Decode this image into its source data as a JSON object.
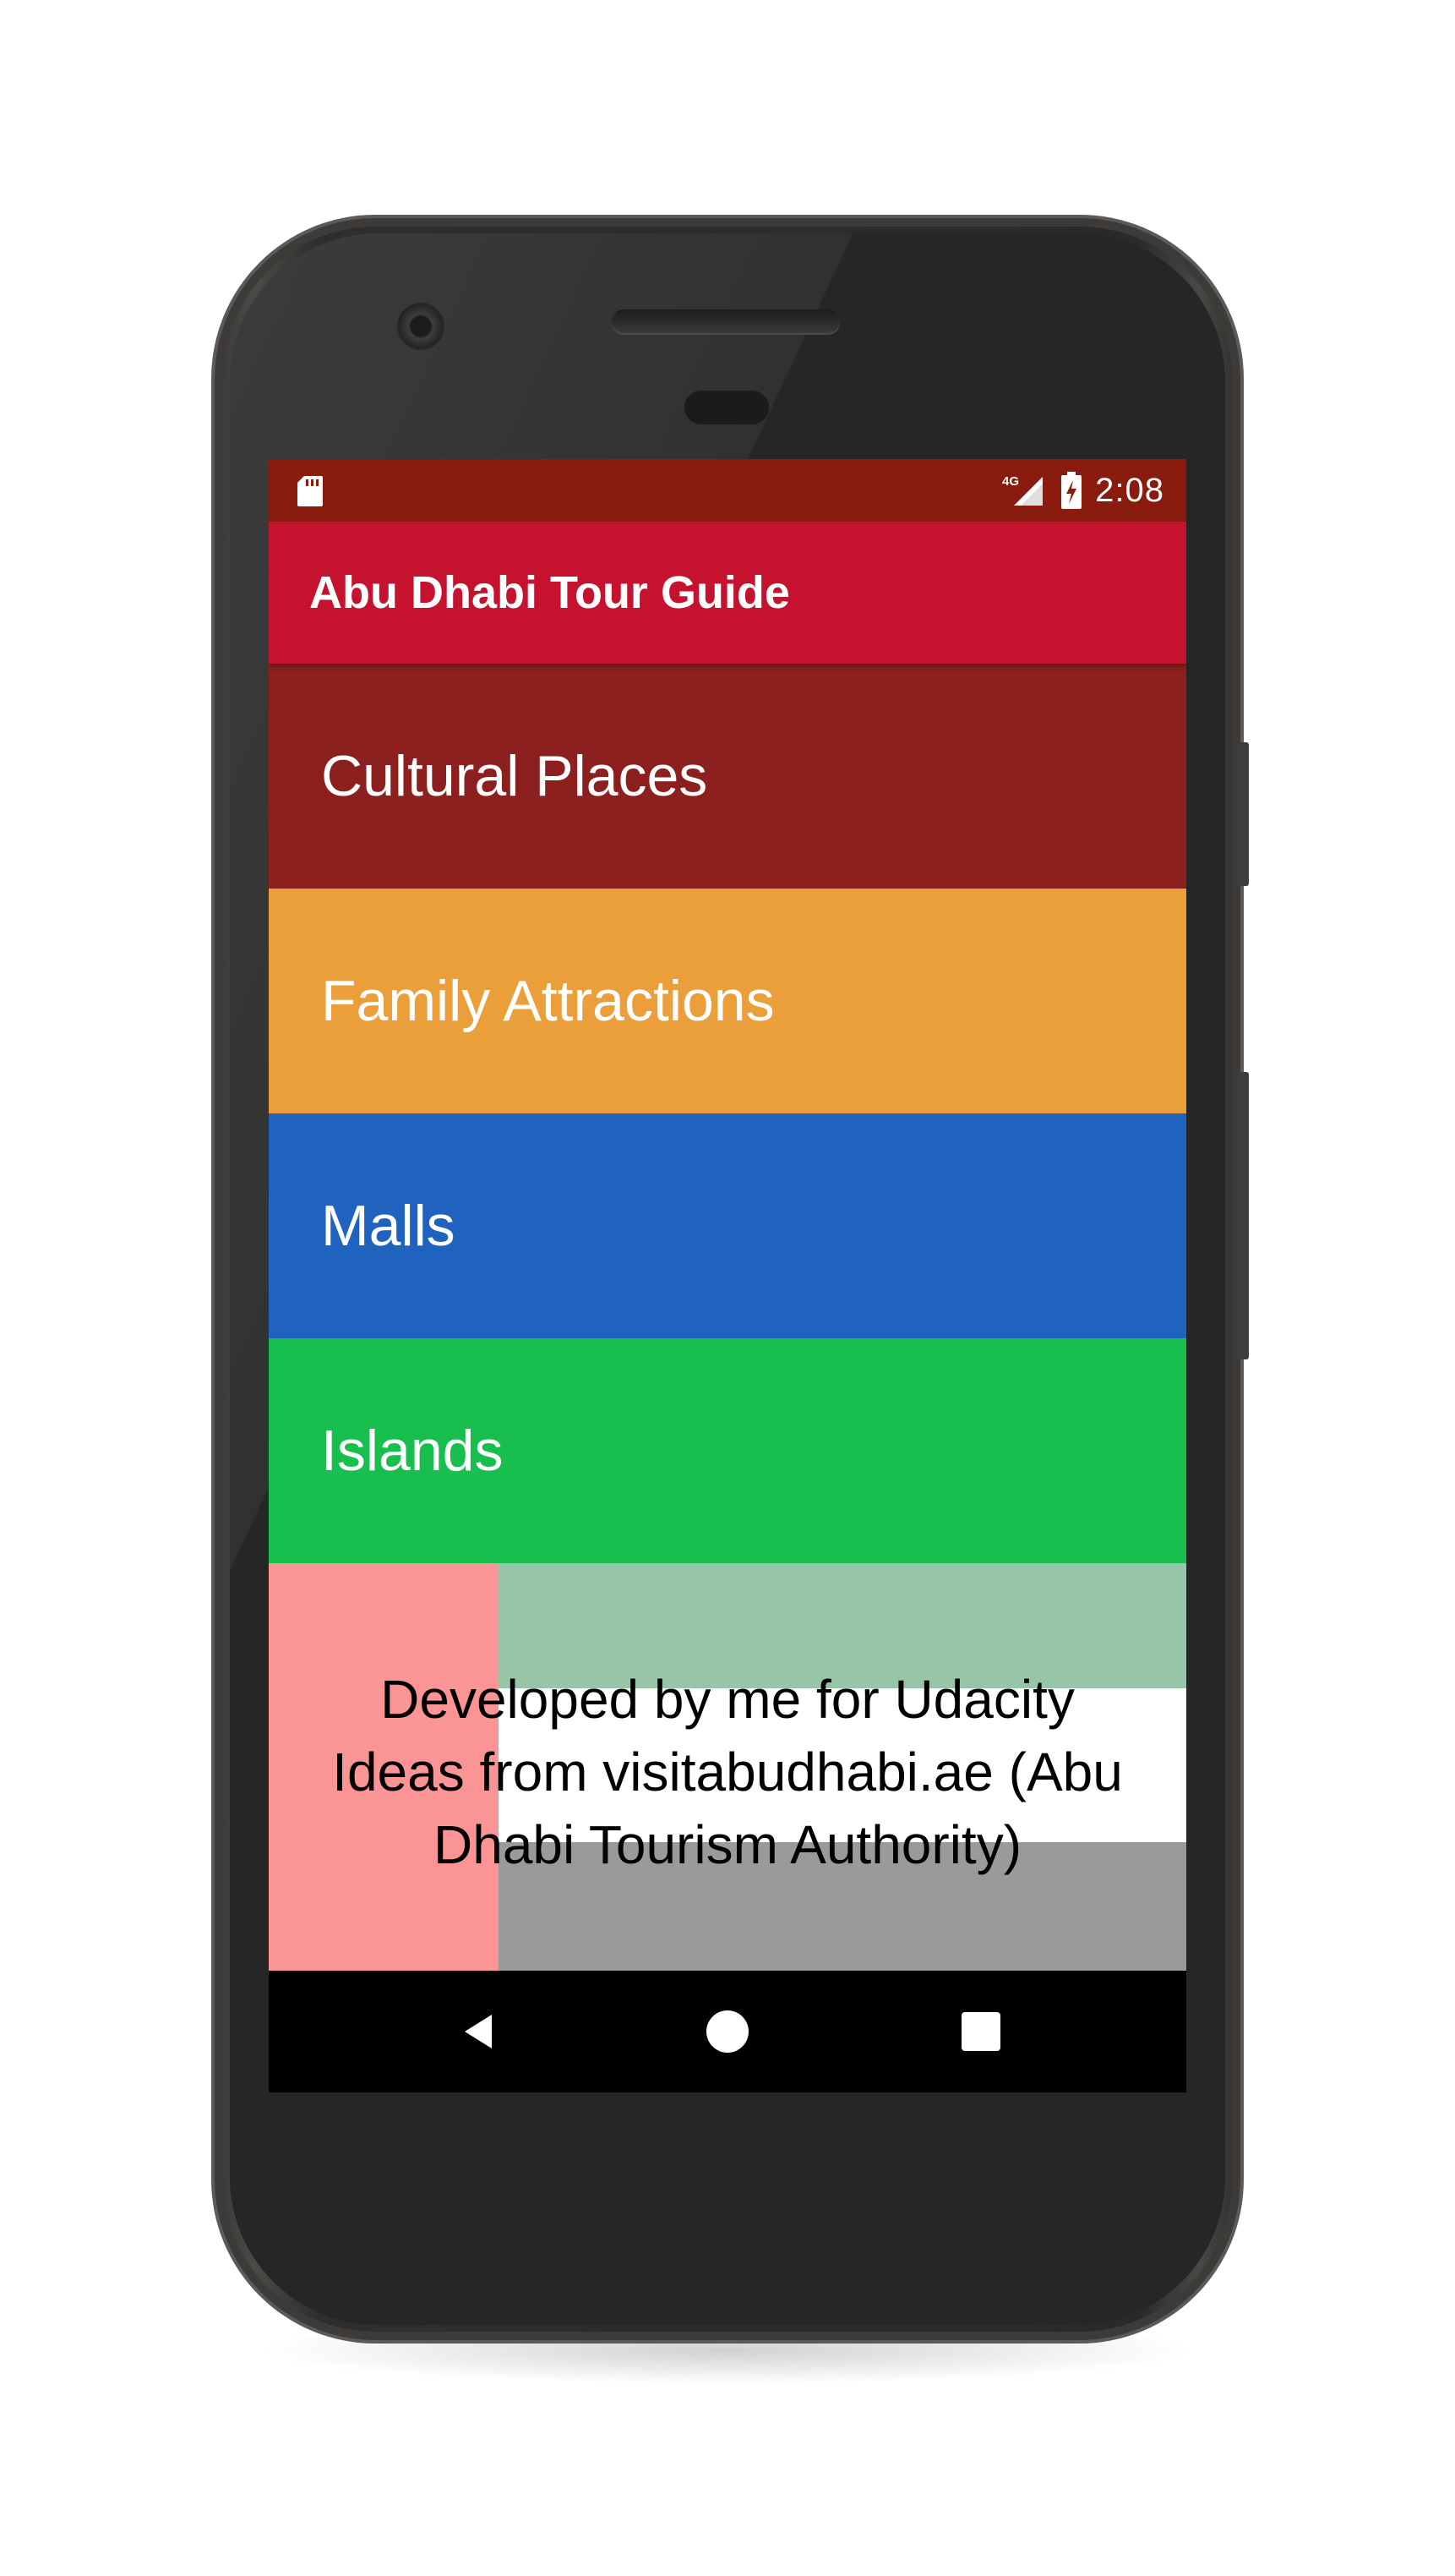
{
  "status_bar": {
    "time": "2:08",
    "network_label": "4G",
    "icons": [
      "sd-card-icon",
      "signal-icon",
      "battery-charging-icon"
    ]
  },
  "app_bar": {
    "title": "Abu Dhabi Tour Guide"
  },
  "categories": [
    {
      "label": "Cultural Places",
      "color": "#8b201e"
    },
    {
      "label": "Family Attractions",
      "color": "#eb9f3b"
    },
    {
      "label": "Malls",
      "color": "#1f63bf"
    },
    {
      "label": "Islands",
      "color": "#18bf4f"
    }
  ],
  "footer": {
    "lines": [
      "Developed by me for Udacity",
      "Ideas from visitabudhabi.ae (Abu",
      "Dhabi Tourism Authority)"
    ],
    "flag_colors": {
      "red": "#fb9595",
      "green": "#97c5a8",
      "white": "#ffffff",
      "black": "#9a9a9a"
    }
  },
  "nav_bar": {
    "buttons": [
      "back-icon",
      "home-icon",
      "recents-icon"
    ]
  }
}
